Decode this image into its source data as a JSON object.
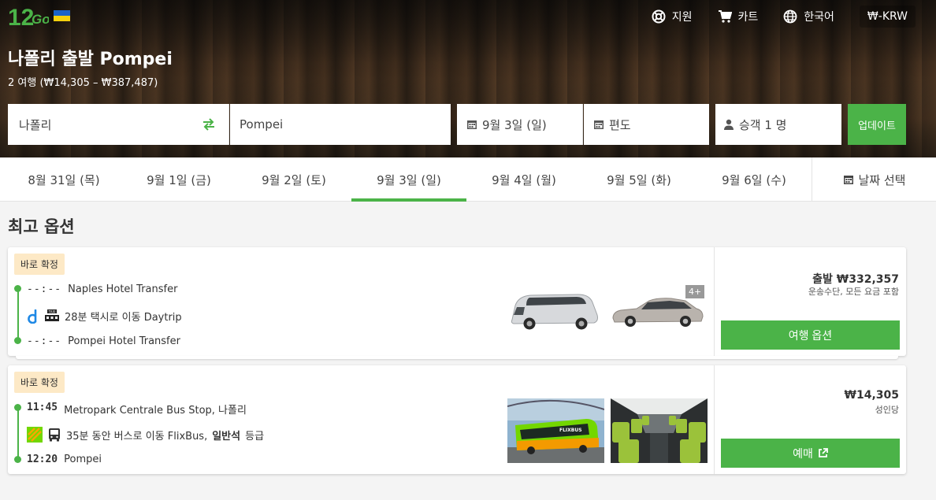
{
  "header": {
    "nav": [
      {
        "label": "지원",
        "icon": "lifebuoy-icon"
      },
      {
        "label": "카트",
        "icon": "cart-icon"
      },
      {
        "label": "한국어",
        "icon": "globe-icon"
      }
    ],
    "currency": "₩-KRW",
    "title": "나폴리 출발 Pompei",
    "subtitle": "2 여행 (₩14,305 – ₩387,487)"
  },
  "search": {
    "from": "나폴리",
    "to": "Pompei",
    "date": "9월 3일 (일)",
    "trip_type": "편도",
    "passengers": "승객 1 명",
    "update_label": "업데이트"
  },
  "dates": {
    "tabs": [
      "8월 31일 (목)",
      "9월 1일 (금)",
      "9월 2일 (토)",
      "9월 3일 (일)",
      "9월 4일 (월)",
      "9월 5일 (화)",
      "9월 6일 (수)"
    ],
    "active_index": 3,
    "pick_label": "날짜 선택"
  },
  "section_title": "최고 옵션",
  "results": [
    {
      "badge": "바로 확정",
      "dep_time": "--:--",
      "dep_stop": "Naples Hotel Transfer",
      "leg_text": "28분 택시로 이동 Daytrip",
      "arr_time": "--:--",
      "arr_stop": "Pompei Hotel Transfer",
      "more": "4+",
      "price": "출발 ₩332,357",
      "price_note": "운송수단, 모든 요금 포함",
      "button": "여행 옵션"
    },
    {
      "badge": "바로 확정",
      "dep_time": "11:45",
      "dep_stop": "Metropark Centrale Bus Stop, 나폴리",
      "leg_pre": "35분 동안 버스로 이동 FlixBus,",
      "leg_class": "일반석",
      "leg_post": "등급",
      "arr_time": "12:20",
      "arr_stop": "Pompei",
      "photo_label": "FLIXBUS",
      "price": "₩14,305",
      "price_note": "성인당",
      "button": "예매"
    }
  ],
  "colors": {
    "accent": "#4bb348",
    "badge": "#fde9c6"
  }
}
